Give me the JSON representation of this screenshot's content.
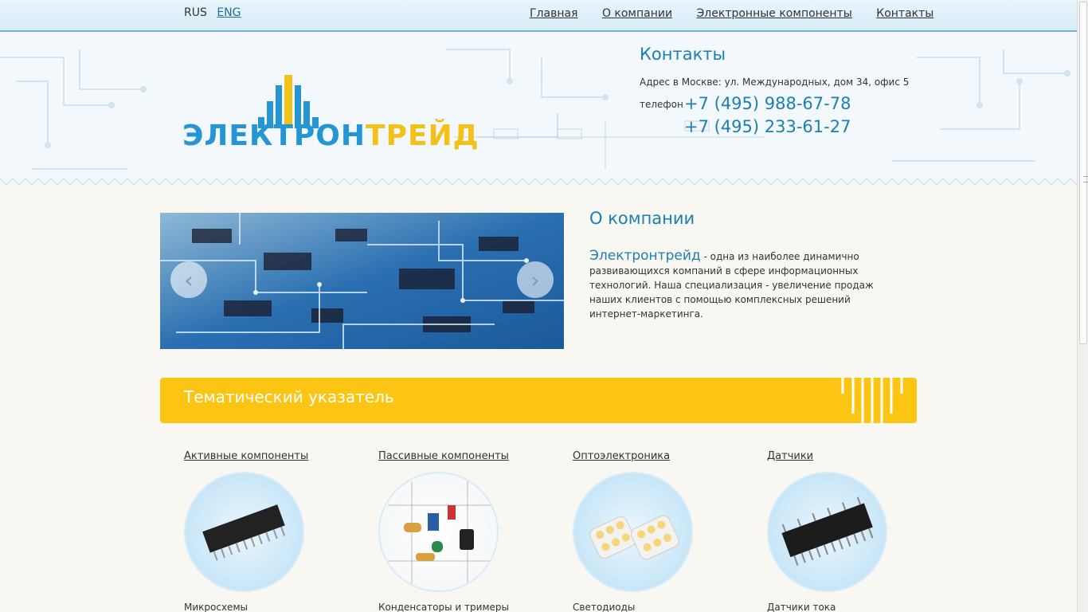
{
  "lang": {
    "rus": "RUS",
    "eng": "ENG"
  },
  "nav": [
    "Главная",
    "О компании",
    "Электронные компоненты",
    "Контакты"
  ],
  "logo": {
    "part1": "ЭЛЕКТРОН",
    "part2": "ТРЕЙД"
  },
  "contacts": {
    "title": "Контакты",
    "address": "Адрес в Москве: ул. Международных, дом 34, офис 5",
    "phone_label": "телефон",
    "phones": [
      "+7 (495) 988-67-78",
      "+7 (495) 233-61-27"
    ]
  },
  "about": {
    "title": "О компании",
    "brand": "Электронтрейд",
    "text": " - одна из наиболее динамично развивающихся компаний в сфере информационных технологий. Наша специализация - увеличение продаж наших клиентов с помощью комплексных решений интернет-маркетинга."
  },
  "index": {
    "title": "Тематический указатель"
  },
  "categories": [
    {
      "title": "Активные компоненты",
      "subtitle": "Микросхемы"
    },
    {
      "title": "Пассивные компоненты",
      "subtitle": "Конденсаторы и тримеры"
    },
    {
      "title": "Оптоэлектроника",
      "subtitle": "Светодиоды"
    },
    {
      "title": "Датчики",
      "subtitle": "Датчики тока"
    }
  ],
  "colors": {
    "accent_blue": "#1c7fb3",
    "logo_blue": "#2596d3",
    "logo_yellow": "#f3c21a",
    "banner": "#fcc514"
  }
}
